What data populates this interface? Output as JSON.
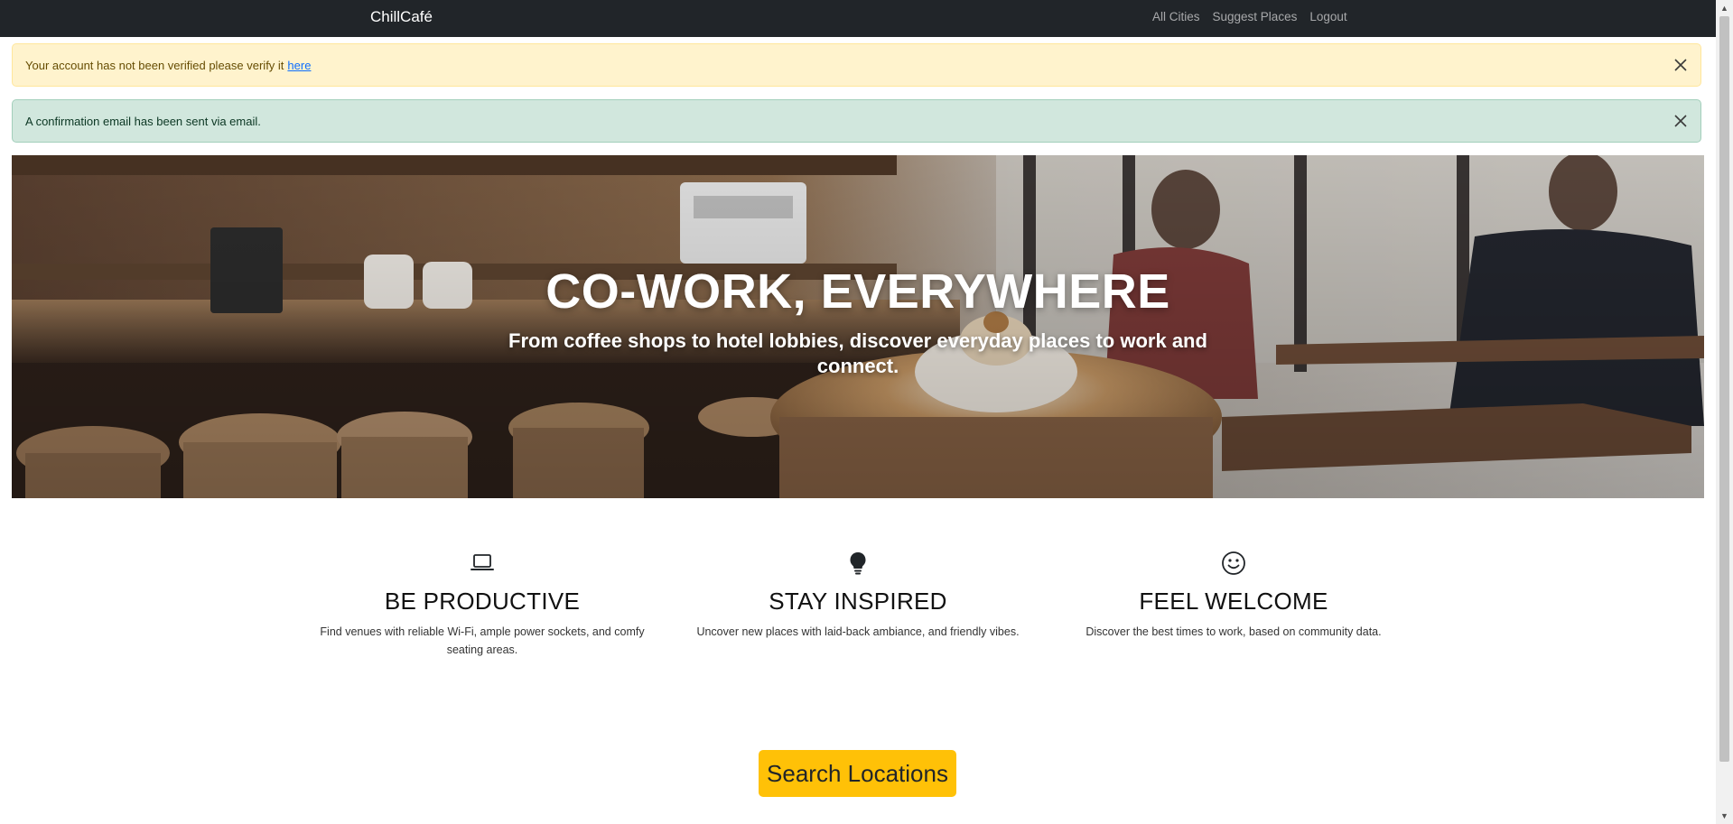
{
  "navbar": {
    "brand": "ChillCafé",
    "links": [
      "All Cities",
      "Suggest Places",
      "Logout"
    ]
  },
  "alerts": {
    "verify": {
      "text": "Your account has not been verified please verify it",
      "link": "here"
    },
    "confirmation": {
      "text": "A confirmation email has been sent via email."
    }
  },
  "hero": {
    "title": "CO-WORK, EVERYWHERE",
    "subtitle": "From coffee shops to hotel lobbies, discover everyday places to work and connect."
  },
  "features": [
    {
      "icon": "laptop-icon",
      "title": "BE PRODUCTIVE",
      "text": "Find venues with reliable Wi-Fi, ample power sockets, and comfy seating areas."
    },
    {
      "icon": "lightbulb-icon",
      "title": "STAY INSPIRED",
      "text": "Uncover new places with laid-back ambiance, and friendly vibes."
    },
    {
      "icon": "smile-icon",
      "title": "FEEL WELCOME",
      "text": "Discover the best times to work, based on community data."
    }
  ],
  "cta": {
    "label": "Search Locations"
  },
  "colors": {
    "navbar": "#212529",
    "warning_bg": "#fff3cd",
    "success_bg": "#d1e7dd",
    "cta": "#ffc107"
  }
}
